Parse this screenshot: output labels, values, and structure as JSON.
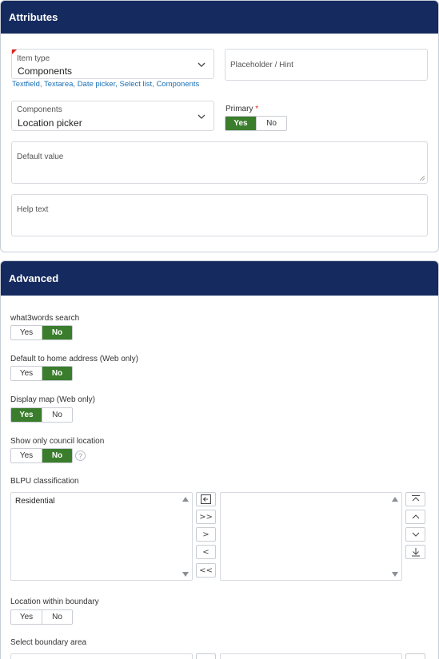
{
  "attributes": {
    "title": "Attributes",
    "item_type": {
      "label": "Item type",
      "value": "Components"
    },
    "placeholder_field": {
      "placeholder": "Placeholder / Hint"
    },
    "item_type_options": [
      "Textfield",
      "Textarea",
      "Date picker",
      "Select list",
      "Components"
    ],
    "components": {
      "label": "Components",
      "value": "Location picker"
    },
    "primary": {
      "label": "Primary",
      "required_mark": "*",
      "options": [
        "Yes",
        "No"
      ],
      "selected": "Yes"
    },
    "default_value": {
      "label": "Default value"
    },
    "help_text": {
      "label": "Help text"
    }
  },
  "advanced": {
    "title": "Advanced",
    "what3words": {
      "label": "what3words search",
      "options": [
        "Yes",
        "No"
      ],
      "selected": "No"
    },
    "default_home": {
      "label": "Default to home address (Web only)",
      "options": [
        "Yes",
        "No"
      ],
      "selected": "No"
    },
    "display_map": {
      "label": "Display map (Web only)",
      "options": [
        "Yes",
        "No"
      ],
      "selected": "Yes"
    },
    "council_location": {
      "label": "Show only council location",
      "options": [
        "Yes",
        "No"
      ],
      "selected": "No",
      "help": "?"
    },
    "blpu": {
      "label": "BLPU classification",
      "available": [
        "Residential"
      ],
      "selected_items": [],
      "transfer_buttons": [
        ">>",
        ">",
        "<",
        "<<"
      ]
    },
    "location_boundary": {
      "label": "Location within boundary",
      "options": [
        "Yes",
        "No"
      ],
      "selected": "none"
    },
    "boundary_area": {
      "label": "Select boundary area"
    }
  },
  "colors": {
    "header": "#152a5e",
    "selected": "#3a7d2c",
    "link": "#1a6fb5",
    "required": "#d9261c"
  }
}
